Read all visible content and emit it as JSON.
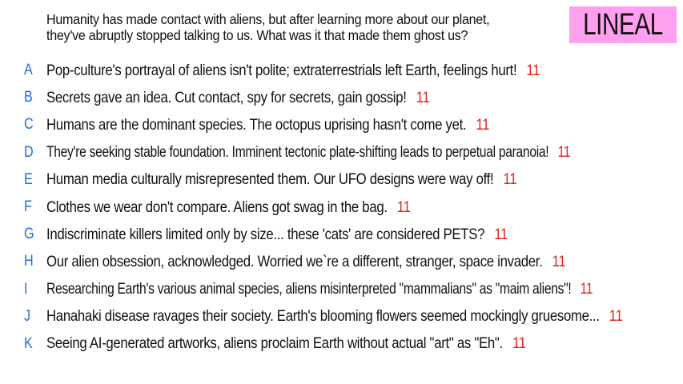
{
  "question": {
    "line1": "Humanity has made contact with aliens, but after learning more about our planet,",
    "line2": "they've abruptly stopped talking to us. What was it that made them ghost us?"
  },
  "badge": {
    "label": "LINEAL",
    "color": "#ff9ff0"
  },
  "colors": {
    "letter": "#1f6fe0",
    "score": "#e0261a",
    "text": "#111111"
  },
  "answers": [
    {
      "letter": "A",
      "text": "Pop-culture's portrayal of aliens isn't polite; extraterrestrials left Earth, feelings hurt!",
      "score": "11"
    },
    {
      "letter": "B",
      "text": "Secrets gave an idea. Cut contact, spy for secrets, gain gossip!",
      "score": "11"
    },
    {
      "letter": "C",
      "text": "Humans are the dominant species. The octopus uprising hasn't come yet.",
      "score": "11"
    },
    {
      "letter": "D",
      "text": "They're seeking stable foundation. Imminent tectonic plate-shifting leads to perpetual paranoia!",
      "score": "11"
    },
    {
      "letter": "E",
      "text": "Human media culturally misrepresented them. Our UFO designs were way off!",
      "score": "11"
    },
    {
      "letter": "F",
      "text": "Clothes we wear don't compare. Aliens got swag in the bag.",
      "score": "11"
    },
    {
      "letter": "G",
      "text": "Indiscriminate killers limited only by size... these 'cats' are considered PETS?",
      "score": "11"
    },
    {
      "letter": "H",
      "text": "Our alien obsession, acknowledged. Worried we`re a different, stranger, space invader.",
      "score": "11"
    },
    {
      "letter": "I",
      "text": "Researching Earth's various animal species, aliens misinterpreted \"mammalians\" as \"maim aliens\"!",
      "score": "11"
    },
    {
      "letter": "J",
      "text": "Hanahaki disease ravages their society. Earth's blooming flowers seemed mockingly gruesome...",
      "score": "11"
    },
    {
      "letter": "K",
      "text": "Seeing AI-generated artworks, aliens proclaim Earth without actual \"art\" as \"Eh\".",
      "score": "11"
    }
  ]
}
